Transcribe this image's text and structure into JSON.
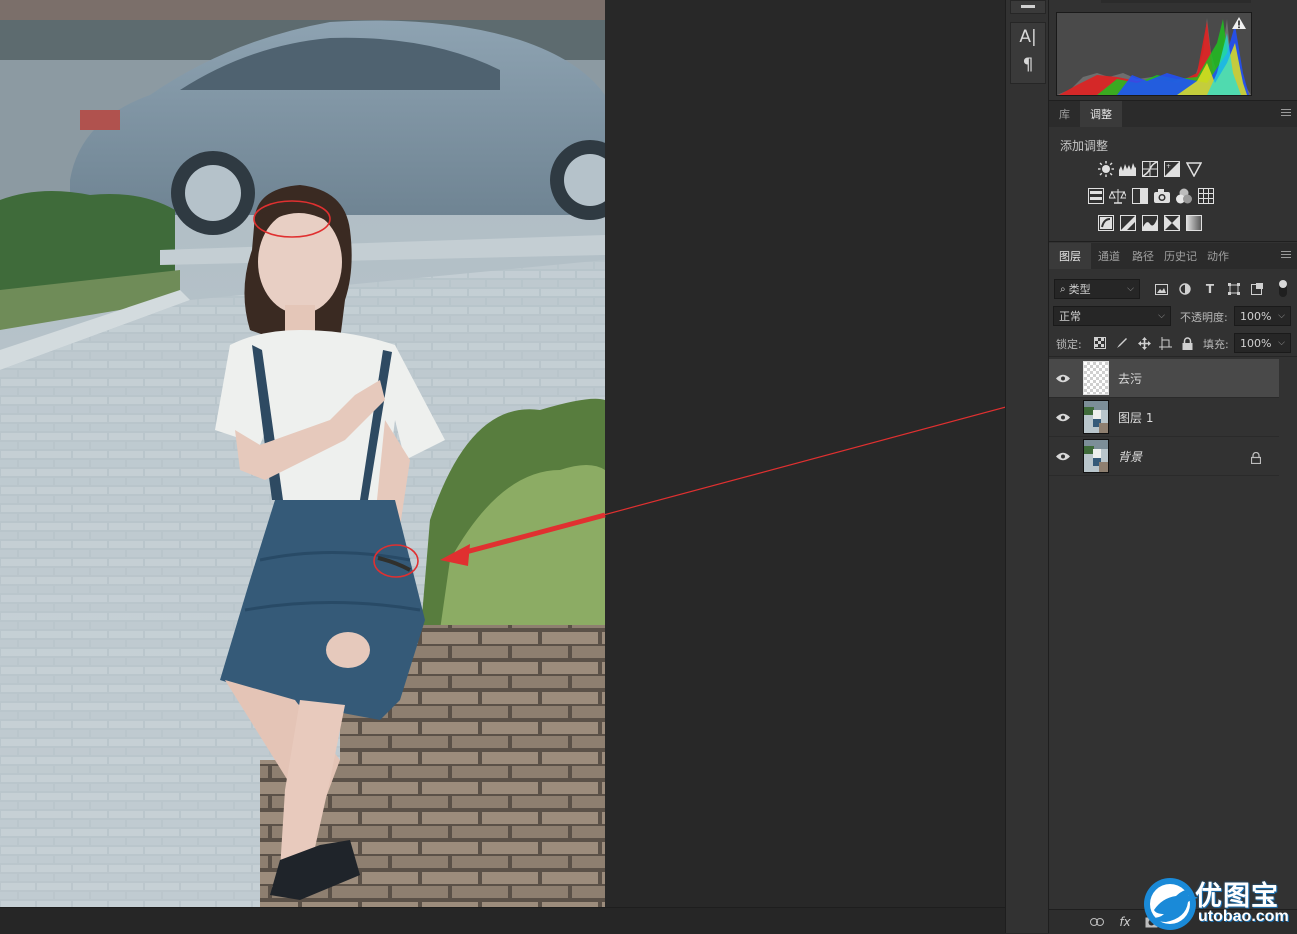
{
  "tools": {
    "type_icon": "A|",
    "paragraph_icon": "¶"
  },
  "library_panel": {
    "tabs": [
      {
        "label": "库"
      },
      {
        "label": "调整"
      }
    ],
    "add_adjustment_label": "添加调整"
  },
  "layers_panel": {
    "tabs": [
      {
        "label": "图层"
      },
      {
        "label": "通道"
      },
      {
        "label": "路径"
      },
      {
        "label": "历史记"
      },
      {
        "label": "动作"
      }
    ],
    "filter_kind": "类型",
    "blend_mode": "正常",
    "opacity_label": "不透明度:",
    "opacity_value": "100%",
    "lock_label": "锁定:",
    "fill_label": "填充:",
    "fill_value": "100%",
    "layers": [
      {
        "name": "去污",
        "visible": true,
        "selected": true
      },
      {
        "name": "图层 1",
        "visible": true,
        "selected": false
      },
      {
        "name": "背景",
        "visible": true,
        "selected": false,
        "locked": true
      }
    ],
    "bottom": {
      "fx_label": "fx"
    }
  },
  "watermark": {
    "brand_cn": "优图宝",
    "brand_url": "utobao.com"
  },
  "colors": {
    "annotation_red": "#e03030",
    "panel_bg": "#323232",
    "canvas_bg": "#282828",
    "selected_row": "#494949"
  }
}
